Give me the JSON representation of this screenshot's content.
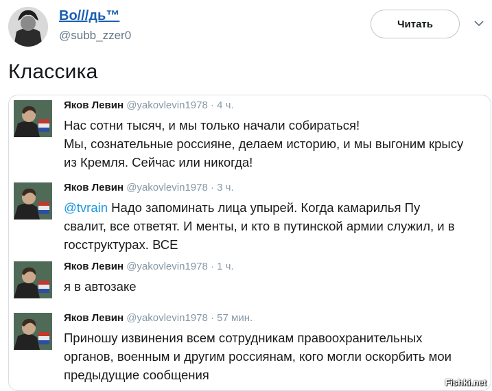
{
  "header": {
    "display_name": "Во///дь™",
    "handle": "@subb_zzer0",
    "follow_label": "Читать"
  },
  "tweet": {
    "text": "Классика"
  },
  "embedded": {
    "entries": [
      {
        "name": "Яков Левин",
        "handle": "@yakovlevin1978",
        "time": "· 4 ч.",
        "lines": [
          "Нас сотни тысяч, и мы только начали собираться!",
          "Мы, сознательные россияне, делаем историю, и мы выгоним крысу",
          "из Кремля. Сейчас или никогда!"
        ]
      },
      {
        "name": "Яков Левин",
        "handle": "@yakovlevin1978",
        "time": "· 3 ч.",
        "mention": "@tvrain",
        "lines": [
          " Надо запоминать лица упырей. Когда камарилья Пу",
          "свалит, все ответят. И менты, и кто в путинской армии служил, и в",
          "госструктурах. ВСЕ"
        ]
      },
      {
        "name": "Яков Левин",
        "handle": "@yakovlevin1978",
        "time": "· 1 ч.",
        "lines": [
          "я в автозаке"
        ]
      },
      {
        "name": "Яков Левин",
        "handle": "@yakovlevin1978",
        "time": "· 57 мин.",
        "lines": [
          "Приношу извинения всем сотрудникам правоохранительных",
          "органов, военным и другим россиянам, кого могли оскорбить мои",
          "предыдущие сообщения"
        ]
      }
    ]
  },
  "watermark": "Fishki.net"
}
